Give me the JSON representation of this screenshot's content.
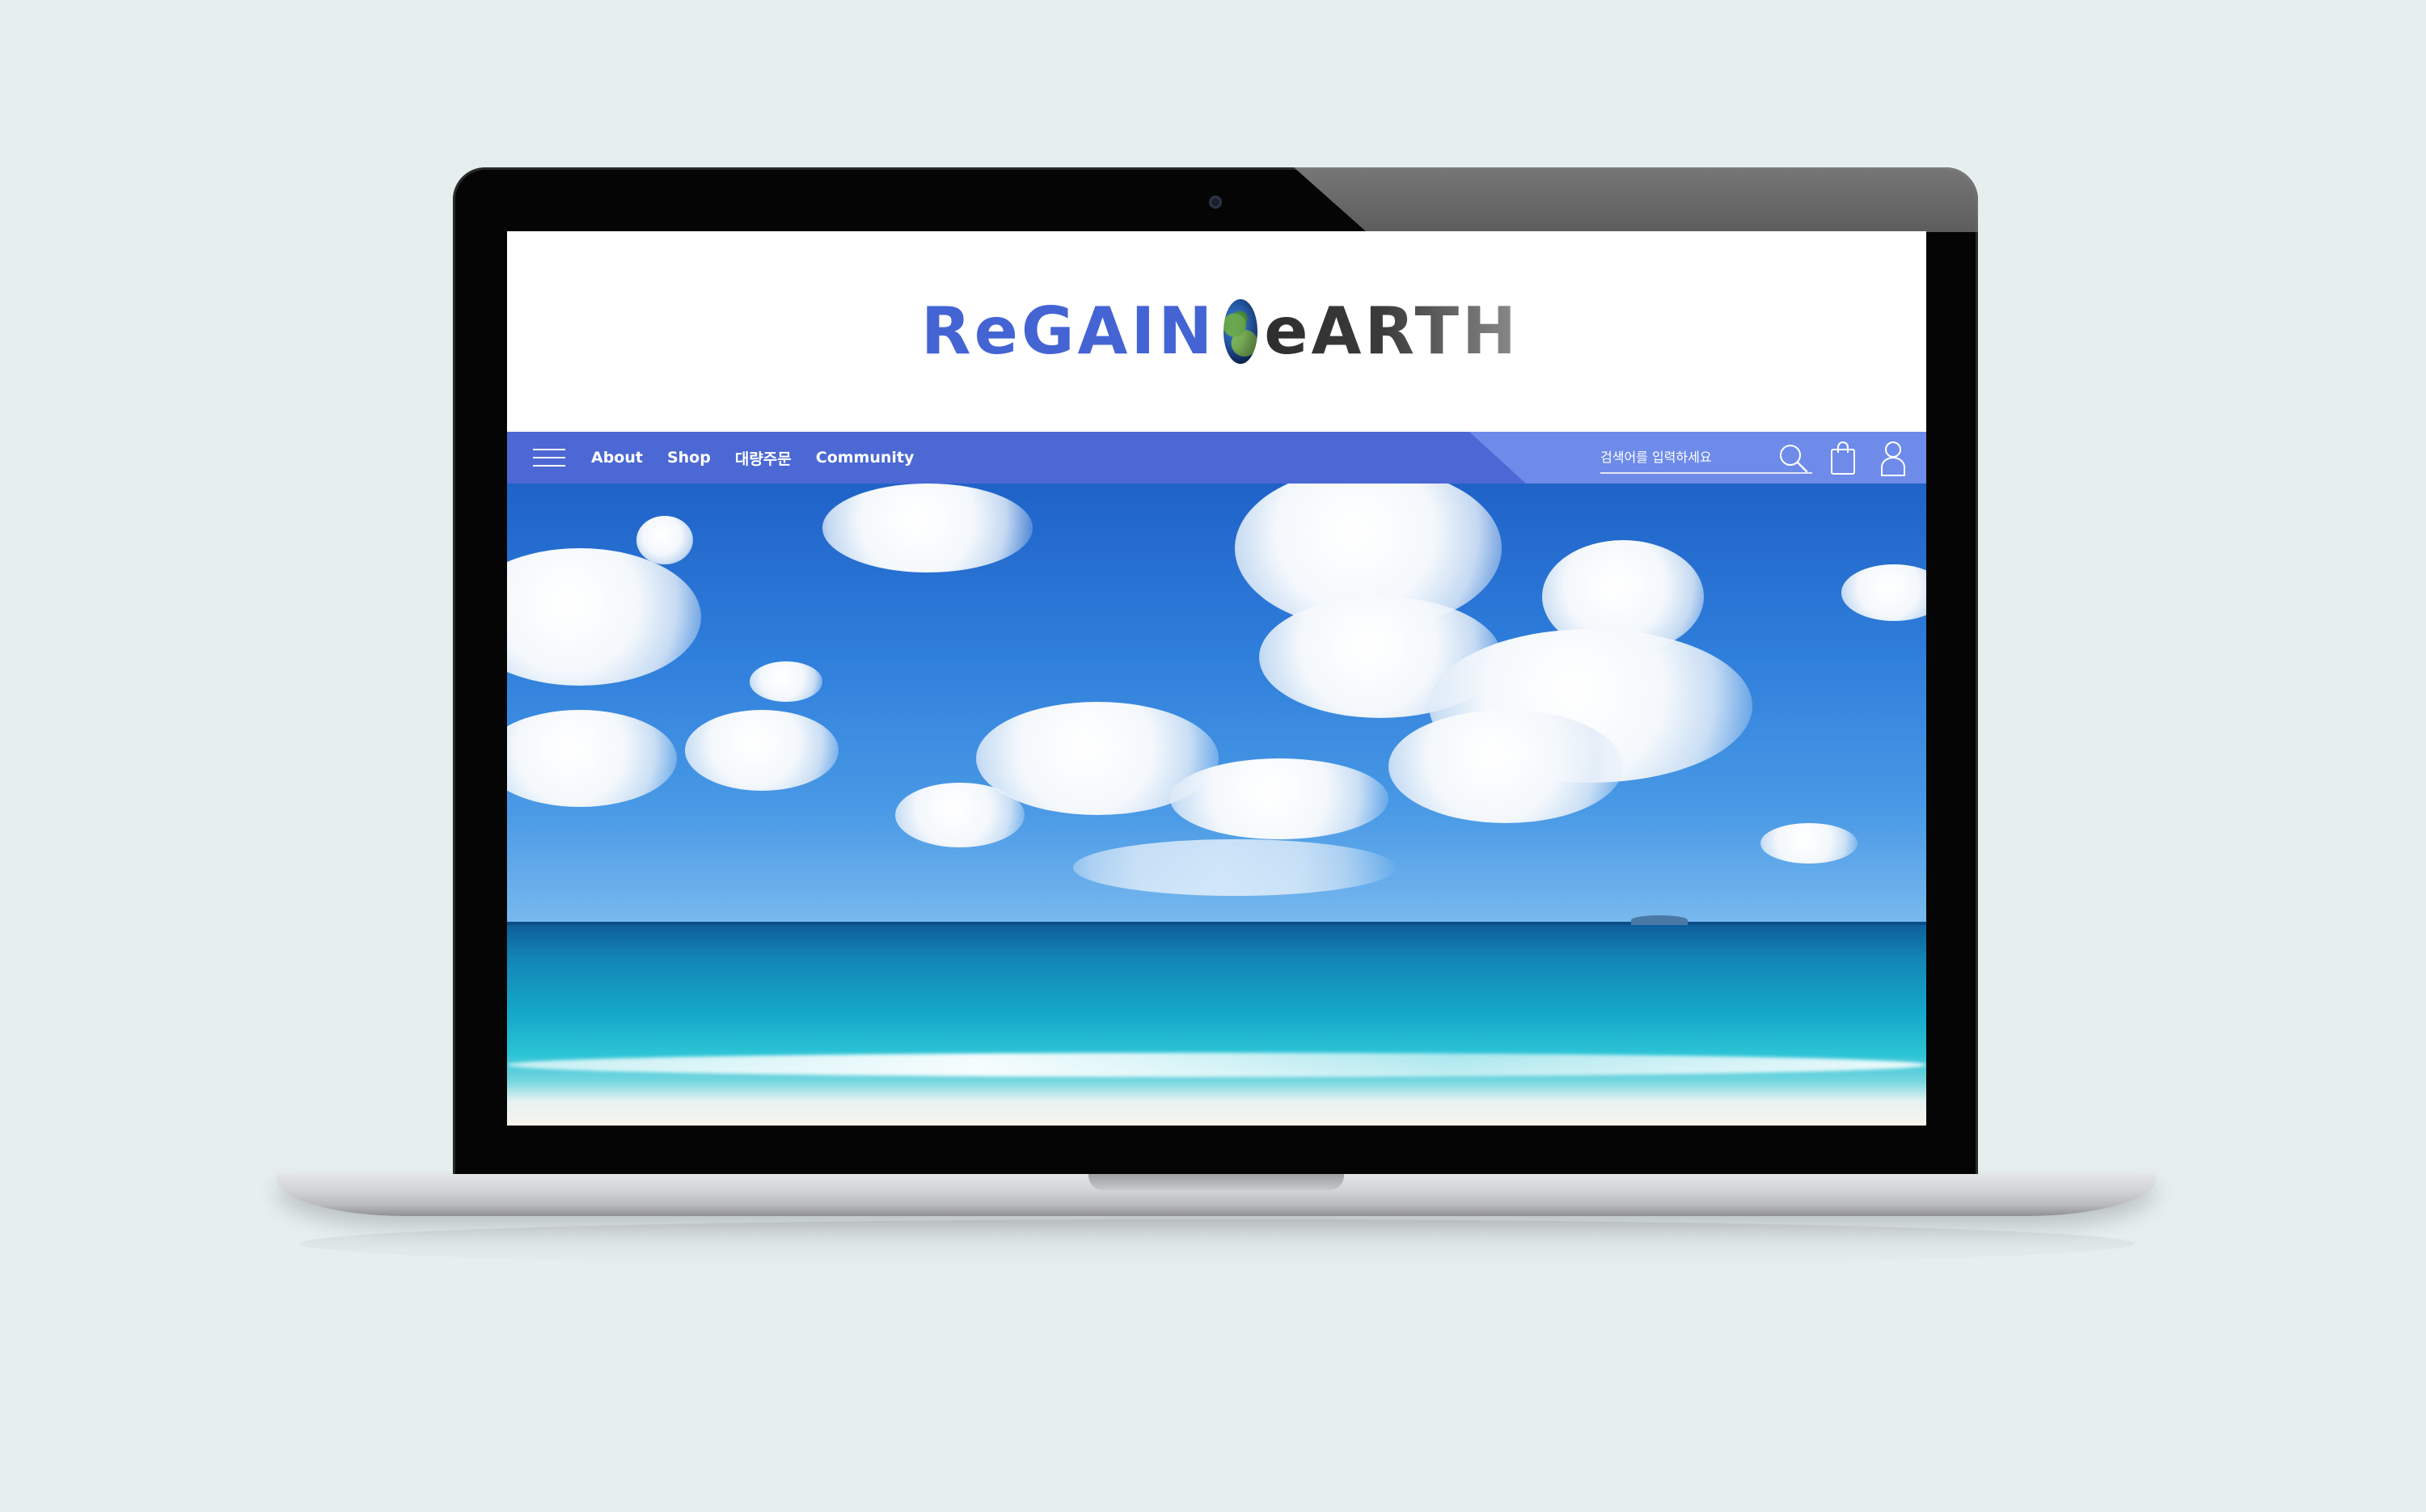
{
  "site": {
    "logo_regain": "ReGAIN",
    "logo_earth": "eARTH"
  },
  "nav": {
    "items": [
      {
        "label": "About"
      },
      {
        "label": "Shop"
      },
      {
        "label": "대량주문"
      },
      {
        "label": "Community"
      }
    ],
    "search_placeholder": "검색어를 입력하세요"
  },
  "icons": {
    "menu": "hamburger-menu-icon",
    "search": "search-icon",
    "bag": "shopping-bag-icon",
    "user": "user-icon",
    "logo_globe": "globe-icon"
  },
  "colors": {
    "brand_blue": "#4b68d4",
    "nav_accent": "#6e8bea",
    "logo_blue": "#4464d4",
    "logo_dark": "#2e2e2e"
  },
  "hero": {
    "image": "tropical beach with blue sky and clouds"
  }
}
